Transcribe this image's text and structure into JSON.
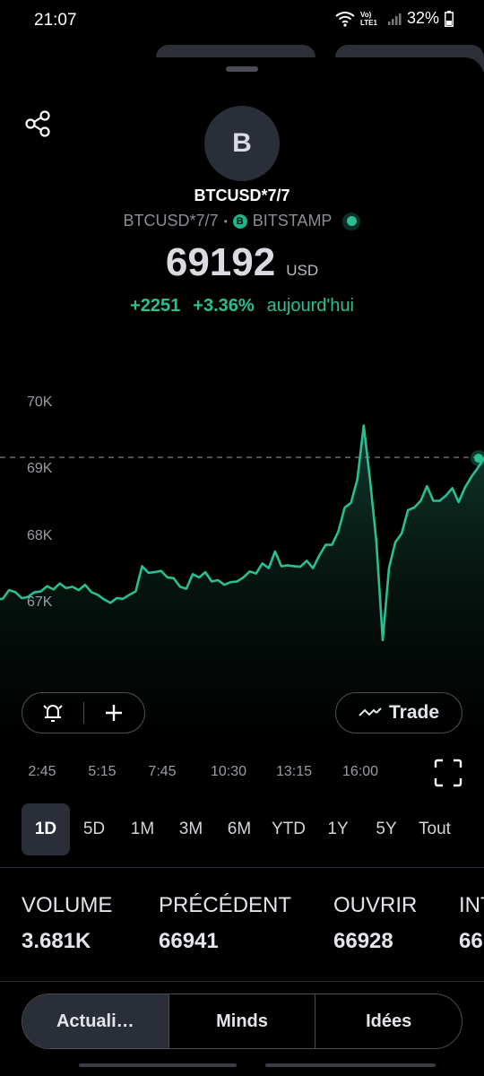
{
  "status": {
    "time": "21:07",
    "battery": "32%",
    "net_label": "Vo) LTE1",
    "icons": [
      "wifi-icon",
      "lte-icon",
      "signal-icon",
      "battery-icon"
    ]
  },
  "header": {
    "avatar_letter": "B",
    "symbol": "BTCUSD*7/7",
    "symbol_sub": "BTCUSD*7/7",
    "separator": "•",
    "exchange_badge": "B",
    "exchange": "BITSTAMP",
    "price": "69192",
    "currency": "USD",
    "change_abs": "+2251",
    "change_pct": "+3.36%",
    "change_label": "aujourd'hui"
  },
  "colors": {
    "accent": "#29bf92",
    "background": "#000000",
    "button_bg": "#2a2e39"
  },
  "chart_data": {
    "type": "area",
    "y_ticks": [
      "70K",
      "69K",
      "68K",
      "67K"
    ],
    "x_ticks": [
      "2:45",
      "5:15",
      "7:45",
      "10:30",
      "13:15",
      "16:00"
    ],
    "ylim": [
      66500,
      70300
    ],
    "previous_close_line": 69192,
    "series": [
      {
        "values": [
          67060,
          67070,
          67200,
          67170,
          67080,
          67100,
          67170,
          67180,
          67260,
          67210,
          67300,
          67230,
          67250,
          67200,
          67280,
          67170,
          67130,
          67060,
          67010,
          67080,
          67070,
          67130,
          67180,
          67560,
          67460,
          67470,
          67490,
          67390,
          67380,
          67250,
          67220,
          67440,
          67390,
          67470,
          67330,
          67350,
          67280,
          67320,
          67330,
          67390,
          67480,
          67450,
          67600,
          67530,
          67780,
          67560,
          67570,
          67560,
          67550,
          67640,
          67530,
          67720,
          67880,
          67880,
          68080,
          68440,
          68510,
          68860,
          69670,
          68860,
          67930,
          66450,
          67530,
          67920,
          68050,
          68400,
          68440,
          68540,
          68760,
          68540,
          68540,
          68620,
          68730,
          68520,
          68740,
          68900,
          69030,
          69180
        ]
      }
    ]
  },
  "actions": {
    "trade_label": "Trade"
  },
  "ranges": [
    "1D",
    "5D",
    "1M",
    "3M",
    "6M",
    "YTD",
    "1Y",
    "5Y",
    "Tout"
  ],
  "active_range": "1D",
  "stats": [
    {
      "label": "VOLUME",
      "value": "3.681K"
    },
    {
      "label": "PRÉCÉDENT",
      "value": "66941"
    },
    {
      "label": "OUVRIR",
      "value": "66928"
    },
    {
      "label": "INT",
      "value": "66"
    }
  ],
  "tabs": [
    "Actuali…",
    "Minds",
    "Idées"
  ]
}
